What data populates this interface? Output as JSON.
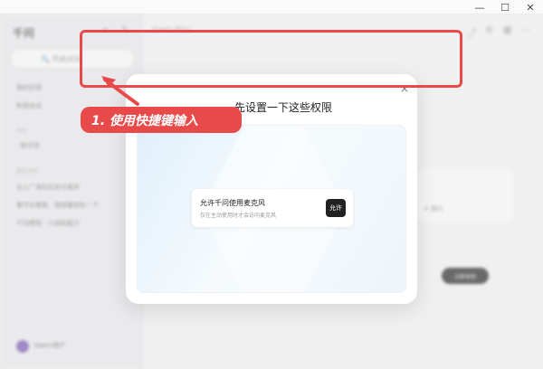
{
  "window": {
    "min": "—",
    "max": "☐",
    "close": "✕"
  },
  "sidebar": {
    "brand": "千问",
    "search_label": "🔍 开启对话",
    "items": [
      {
        "label": "我的应用"
      },
      {
        "label": "新建会话"
      }
    ],
    "section_1": "今日",
    "section_item": "· 新对话",
    "section_2": "最近对话",
    "history": [
      {
        "label": "北上广深的区别与差异"
      },
      {
        "label": "春节去哪里，我想要放松一下"
      },
      {
        "label": "千问模型：介绍和能力"
      }
    ],
    "user_name": "Qwen用户"
  },
  "main": {
    "title": "Qwen-Max",
    "mic_text": "✦ 图片",
    "pill_label": "立即体验"
  },
  "modal": {
    "title": "先设置一下这些权限",
    "close": "×",
    "permission": {
      "label": "允许千问使用麦克风",
      "description": "仅在主动使用时才会访问麦克风",
      "button": "允许"
    }
  },
  "annotation": {
    "callout": "1. 使用快捷键输入",
    "color": "#e84a4a"
  }
}
